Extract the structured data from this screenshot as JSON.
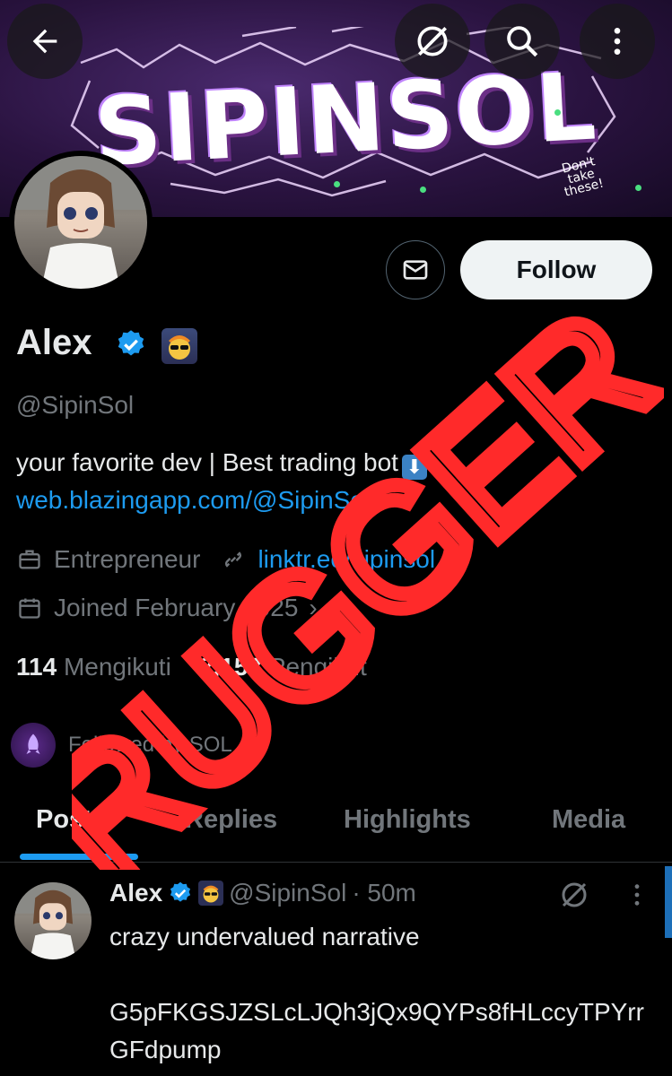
{
  "banner": {
    "title": "SIPINSOL",
    "tagline": "Don't take these!"
  },
  "header": {
    "back_icon": "arrow-left-icon",
    "no_grok_icon": "slashed-circle-icon",
    "search_icon": "search-icon",
    "more_icon": "more-vertical-icon"
  },
  "profile": {
    "name": "Alex",
    "handle": "@SipinSol",
    "bio": "your favorite dev | Best trading bot",
    "bio_link": "web.blazingapp.com/@SipinSol",
    "category": "Entrepreneur",
    "website": "linktr.ee/sipinsol",
    "joined": "Joined February 2025",
    "following_count": "114",
    "following_label": "Mengikuti",
    "followers_count": "2,153",
    "followers_label": "Pengikut",
    "followed_by": "Followed by SOL"
  },
  "actions": {
    "follow_label": "Follow",
    "message_icon": "envelope-icon"
  },
  "tabs": [
    {
      "label": "Posts"
    },
    {
      "label": "Replies"
    },
    {
      "label": "Highlights"
    },
    {
      "label": "Media"
    }
  ],
  "post": {
    "name": "Alex",
    "handle": "@SipinSol",
    "time": "· 50m",
    "text_line1": "crazy undervalued narrative",
    "text_line2": "G5pFKGSJZSLcLJQh3jQx9QYPs8fHLccyTPYrrGFdpump"
  },
  "overlay": {
    "stamp_text": "RUGGER",
    "stamp_color": "#ff2a2a"
  },
  "colors": {
    "accent": "#1d9bf0",
    "background": "#000000",
    "muted": "#71767b"
  }
}
